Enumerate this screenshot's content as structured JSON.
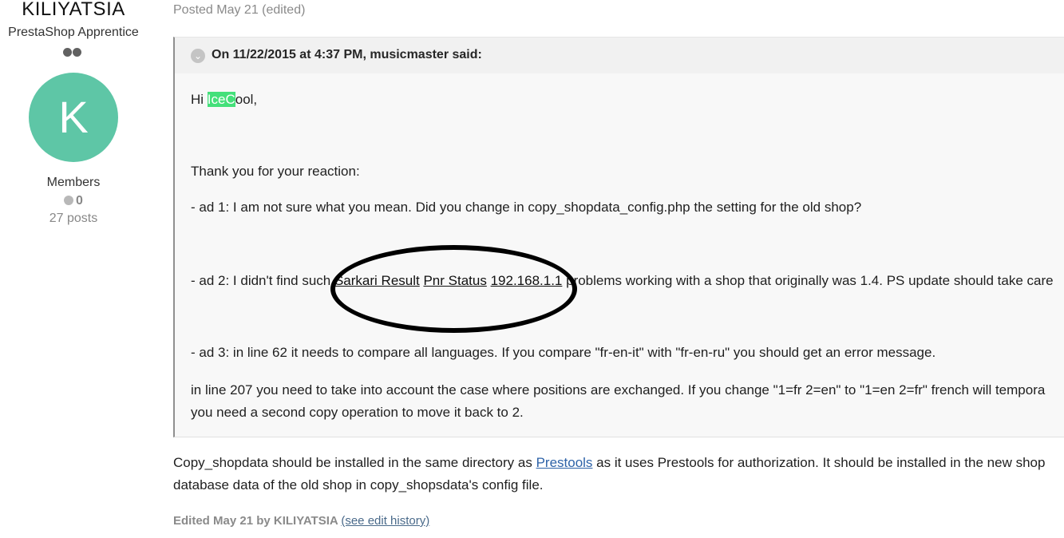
{
  "author": {
    "name": "KILIYATSIA",
    "rank": "PrestaShop Apprentice",
    "avatar_letter": "K",
    "avatar_color": "#5ec6a6",
    "group": "Members",
    "reputation": "0",
    "posts": "27 posts"
  },
  "post": {
    "meta": "Posted May 21 (edited)",
    "quote": {
      "citation": "On 11/22/2015 at 4:37 PM, musicmaster said:",
      "greeting_pre": "Hi ",
      "greeting_highlight": "IceC",
      "greeting_post": "ool,",
      "thanks": "Thank you for your reaction:",
      "ad1": " - ad 1: I am not sure what you mean. Did you change in copy_shopdata_config.php the setting for the old shop?",
      "ad2_pre": " - ad 2: I didn't find such ",
      "ad2_link1": "Sarkari Result",
      "ad2_link2": "Pnr Status",
      "ad2_link3": "192.168.1.1",
      "ad2_post": " problems working with a shop that originally was 1.4. PS update should take care",
      "ad3": " - ad 3: in line 62 it needs to compare all languages. If you compare \"fr-en-it\" with \"fr-en-ru\" you should get an error message.",
      "line207": " in line 207 you need to take into account the case where positions are exchanged. If you change \"1=fr 2=en\" to \"1=en 2=fr\" french will tempora",
      "second_copy": "you need a second copy operation to move it back to 2."
    },
    "body_pre": "Copy_shopdata should be installed in the same directory as ",
    "body_link": "Prestools",
    "body_post": " as it uses Prestools for authorization. It should be installed in the new shop",
    "body_line2": "database data of the old shop in copy_shopsdata's config file.",
    "edited_text": "Edited May 21 by KILIYATSIA ",
    "edit_history_link": "(see edit history)"
  }
}
